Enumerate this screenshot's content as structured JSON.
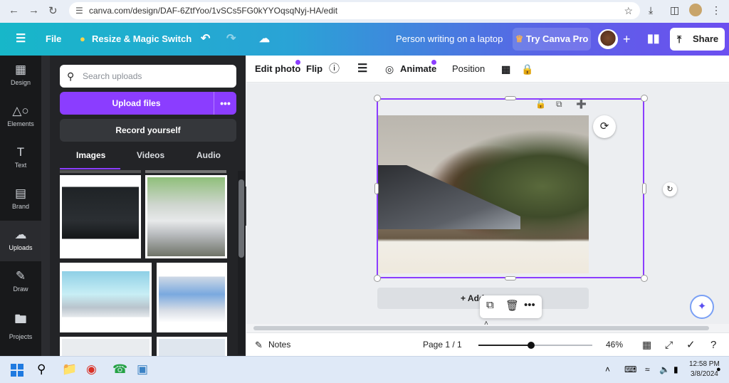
{
  "browser": {
    "url": "canva.com/design/DAF-6ZtfYoo/1vSCs5FG0kYYOqsqNyj-HA/edit",
    "back_icon": "arrow-left-icon",
    "forward_icon": "arrow-right-icon",
    "reload_icon": "reload-icon",
    "bookmark_icon": "star-icon"
  },
  "topbar": {
    "menu_icon": "hamburger-icon",
    "file_label": "File",
    "resize_label": "Resize & Magic Switch",
    "design_title": "Person writing on a laptop",
    "try_pro_label": "Try Canva Pro",
    "share_label": "Share"
  },
  "rail": [
    {
      "label": "Design",
      "icon": "design-icon"
    },
    {
      "label": "Elements",
      "icon": "elements-icon"
    },
    {
      "label": "Text",
      "icon": "text-icon"
    },
    {
      "label": "Brand",
      "icon": "brand-icon"
    },
    {
      "label": "Uploads",
      "icon": "uploads-icon"
    },
    {
      "label": "Draw",
      "icon": "draw-icon"
    },
    {
      "label": "Projects",
      "icon": "projects-icon"
    }
  ],
  "panel": {
    "search_placeholder": "Search uploads",
    "upload_label": "Upload files",
    "record_label": "Record yourself",
    "tabs": [
      "Images",
      "Videos",
      "Audio"
    ],
    "active_tab": "Images"
  },
  "toolbar": {
    "edit_photo": "Edit photo",
    "flip": "Flip",
    "animate": "Animate",
    "position": "Position"
  },
  "canvas": {
    "add_page_label": "+ Add page"
  },
  "footer": {
    "notes_label": "Notes",
    "page_indicator": "Page 1 / 1",
    "zoom_label": "46%",
    "zoom_fraction": 0.46
  },
  "taskbar": {
    "time": "12:58 PM",
    "date": "3/8/2024"
  }
}
